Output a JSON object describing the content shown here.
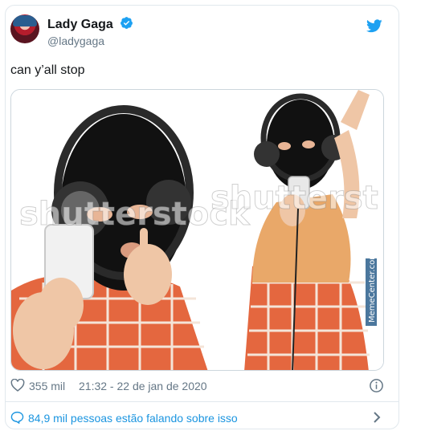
{
  "tweet": {
    "display_name": "Lady Gaga",
    "handle": "@ladygaga",
    "text": "can y’all stop",
    "likes": "355 mil",
    "timestamp": "21:32 - 22 de jan de 2020",
    "talking": "84,9 mil pessoas estão falando sobre isso"
  },
  "media": {
    "watermark_left": "shutterstock",
    "watermark_right": "shutterst",
    "side_credit": "MemeCenter.com"
  },
  "colors": {
    "verified": "#1da1f2",
    "twitter_blue": "#1da1f2",
    "link_blue": "#1b95e0",
    "muted": "#657786"
  },
  "icons": [
    "verified-badge-icon",
    "twitter-bird-icon",
    "heart-icon",
    "info-icon",
    "chat-bubble-icon",
    "chevron-right-icon"
  ]
}
